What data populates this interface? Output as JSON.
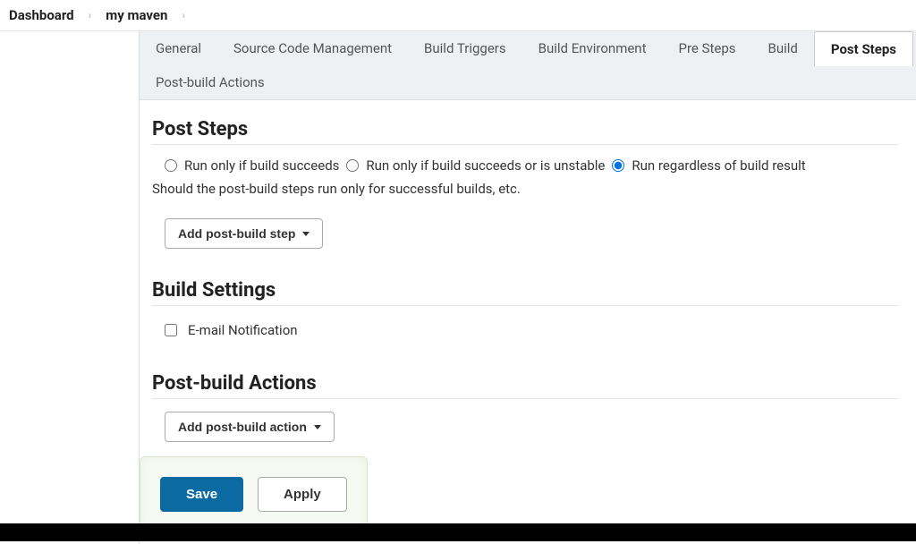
{
  "breadcrumb": {
    "dashboard": "Dashboard",
    "project": "my maven"
  },
  "tabs": [
    {
      "label": "General"
    },
    {
      "label": "Source Code Management"
    },
    {
      "label": "Build Triggers"
    },
    {
      "label": "Build Environment"
    },
    {
      "label": "Pre Steps"
    },
    {
      "label": "Build"
    },
    {
      "label": "Post Steps"
    },
    {
      "label": "Post-build Actions"
    }
  ],
  "active_tab_index": 6,
  "sections": {
    "post_steps": {
      "title": "Post Steps",
      "options": {
        "succeeds": "Run only if build succeeds",
        "unstable": "Run only if build succeeds or is unstable",
        "regardless": "Run regardless of build result"
      },
      "help": "Should the post-build steps run only for successful builds, etc.",
      "add_button": "Add post-build step"
    },
    "build_settings": {
      "title": "Build Settings",
      "email_notification": "E-mail Notification"
    },
    "post_build_actions": {
      "title": "Post-build Actions",
      "add_button": "Add post-build action"
    }
  },
  "footer": {
    "save": "Save",
    "apply": "Apply"
  }
}
